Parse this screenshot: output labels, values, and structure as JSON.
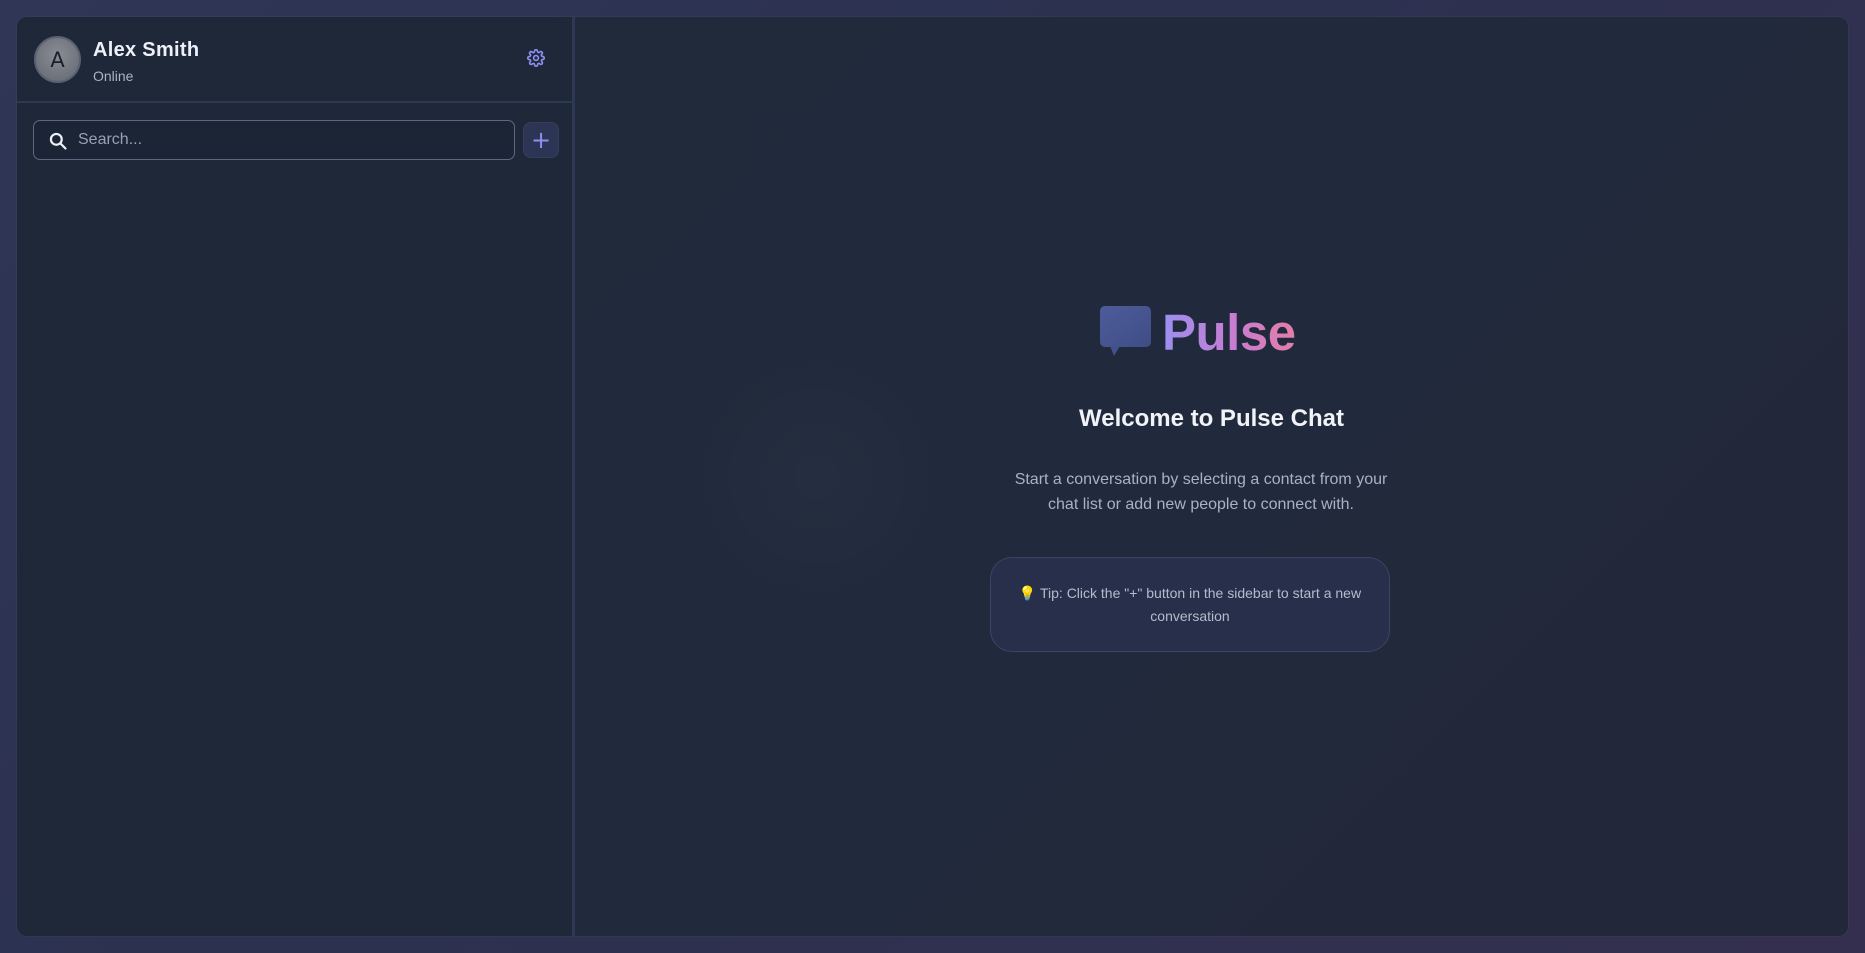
{
  "user": {
    "avatar_initial": "A",
    "name": "Alex Smith",
    "status": "Online"
  },
  "search": {
    "placeholder": "Search..."
  },
  "actions": {
    "add_label": "+"
  },
  "welcome": {
    "logo_text": "Pulse",
    "title": "Welcome to Pulse Chat",
    "description": "Start a conversation by selecting a contact from your chat list or add new people to connect with.",
    "tip": "💡 Tip: Click the \"+\" button in the sidebar to start a new conversation"
  },
  "icons": {
    "settings": "gear-icon",
    "search": "search-icon",
    "logo": "chat-bubble-icon"
  },
  "colors": {
    "accent": "#8d8ff0",
    "logo_gradient_start": "#9b8ff0",
    "logo_gradient_end": "#e57da8",
    "background": "#1f2738"
  }
}
